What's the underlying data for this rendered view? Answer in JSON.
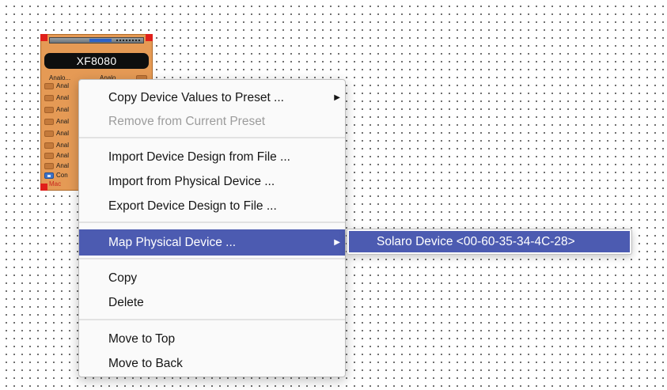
{
  "device": {
    "name": "XF8080",
    "top_ports": [
      "Analo...",
      "Analo..."
    ],
    "left_ports": [
      "Anal",
      "Anal",
      "Anal",
      "Anal",
      "Anal",
      "Anal",
      "Anal",
      "Anal"
    ],
    "control_port": "Con",
    "mac_label": "Mac"
  },
  "context_menu": {
    "copy_to_preset": "Copy Device Values to Preset ...",
    "remove_from_preset": "Remove from Current Preset",
    "import_from_file": "Import Device Design from File ...",
    "import_from_physical": "Import from Physical Device ...",
    "export_to_file": "Export Device Design to File ...",
    "map_physical": "Map Physical Device ...",
    "copy": "Copy",
    "delete": "Delete",
    "move_to_top": "Move to Top",
    "move_to_back": "Move to Back",
    "submenu_arrow": "▶"
  },
  "submenu": {
    "device_entry": "Solaro Device <00-60-35-34-4C-28>"
  },
  "colors": {
    "highlight": "#4c5bb1",
    "device_body": "#e59a55",
    "corner_marker": "#e0201a"
  },
  "icons": [
    "submenu-arrow-icon",
    "control-port-icon",
    "port-connector-icon"
  ]
}
